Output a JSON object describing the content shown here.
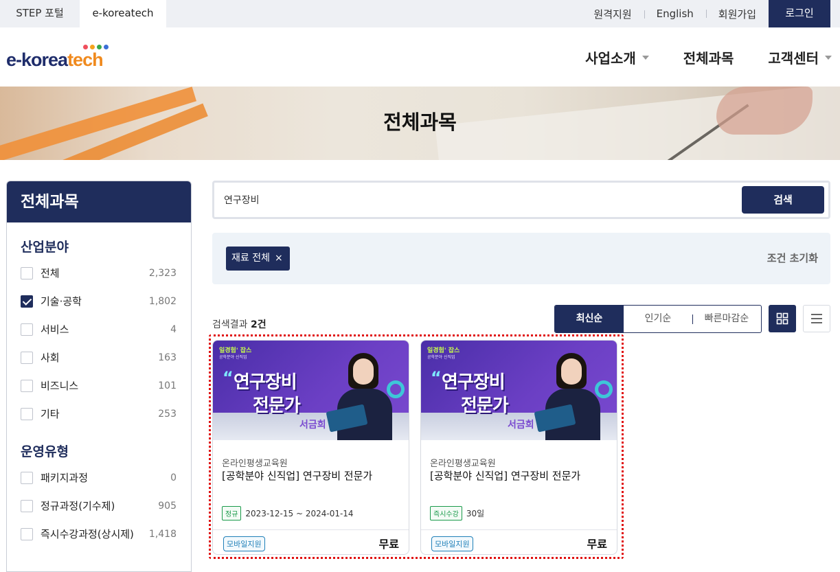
{
  "util": {
    "tab_step": "STEP 포털",
    "tab_active": "e-koreatech",
    "links": [
      "원격지원",
      "English",
      "회원가입"
    ],
    "login": "로그인"
  },
  "header": {
    "logo_prefix": "e-korea",
    "logo_suffix": "tech",
    "logo_dot_colors": [
      "#ef4f5d",
      "#f4a21d",
      "#3aa84a",
      "#3b6fd6"
    ],
    "nav": [
      {
        "label": "사업소개",
        "icon": "caret-down-icon"
      },
      {
        "label": "전체과목"
      },
      {
        "label": "고객센터",
        "icon": "caret-down-icon"
      }
    ]
  },
  "hero": {
    "title": "전체과목"
  },
  "sidebar": {
    "title": "전체과목",
    "industry": {
      "title": "산업분야",
      "items": [
        {
          "label": "전체",
          "count": "2,323",
          "checked": false
        },
        {
          "label": "기술·공학",
          "count": "1,802",
          "checked": true
        },
        {
          "label": "서비스",
          "count": "4",
          "checked": false
        },
        {
          "label": "사회",
          "count": "163",
          "checked": false
        },
        {
          "label": "비즈니스",
          "count": "101",
          "checked": false
        },
        {
          "label": "기타",
          "count": "253",
          "checked": false
        }
      ]
    },
    "operation": {
      "title": "운영유형",
      "items": [
        {
          "label": "패키지과정",
          "count": "0",
          "checked": false
        },
        {
          "label": "정규과정(기수제)",
          "count": "905",
          "checked": false
        },
        {
          "label": "즉시수강과정(상시제)",
          "count": "1,418",
          "checked": false
        }
      ]
    }
  },
  "search": {
    "value": "연구장비",
    "button": "검색"
  },
  "filters": {
    "chip_label": "재료 전체",
    "chip_close": "×",
    "reset": "조건 초기화"
  },
  "results": {
    "count_prefix": "검색결과 ",
    "count_value": "2건",
    "sort": [
      "최신순",
      "인기순",
      "빠른마감순"
    ],
    "active_sort": "최신순",
    "views": [
      "grid-view-icon",
      "list-view-icon"
    ]
  },
  "cards": [
    {
      "thumb_brand": "일경험' 잡스",
      "thumb_sub": "공학분야 신직업",
      "thumb_line1": "연구장비",
      "thumb_line2": "전문가",
      "thumb_name": "서금희",
      "org": "온라인평생교육원",
      "title": "[공학분야 신직업] 연구장비 전문가",
      "tag": "정규",
      "meta": "2023-12-15 ~ 2024-01-14",
      "support": "모바일지원",
      "price": "무료"
    },
    {
      "thumb_brand": "일경험' 잡스",
      "thumb_sub": "공학분야 신직업",
      "thumb_line1": "연구장비",
      "thumb_line2": "전문가",
      "thumb_name": "서금희",
      "org": "온라인평생교육원",
      "title": "[공학분야 신직업] 연구장비 전문가",
      "tag": "즉시수강",
      "meta": "30일",
      "support": "모바일지원",
      "price": "무료"
    }
  ]
}
